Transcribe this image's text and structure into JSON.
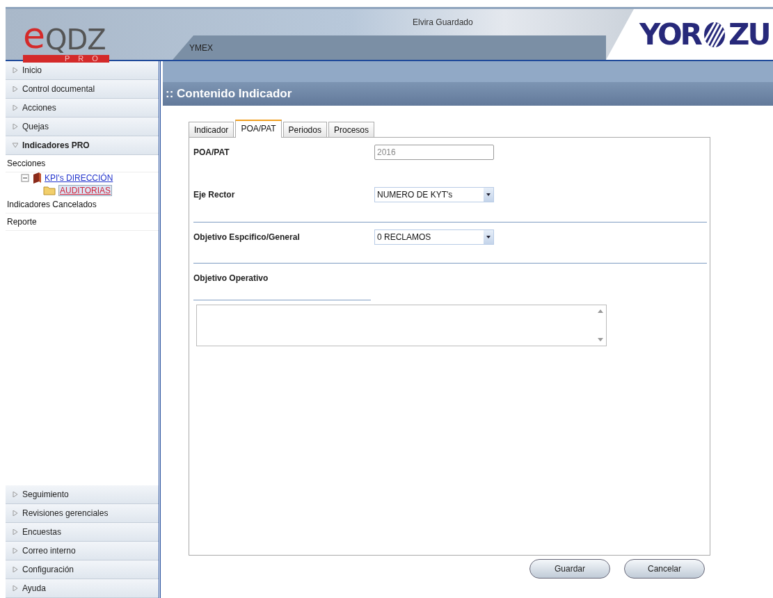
{
  "header": {
    "logo": {
      "mark": "e",
      "name": "QDZ",
      "sub": "PRO"
    },
    "company": "YMEX",
    "user": "Elvira Guardado",
    "brand": {
      "left": "YOR",
      "right": "ZU"
    }
  },
  "sidebar": {
    "items": [
      {
        "label": "Inicio",
        "expanded": false
      },
      {
        "label": "Control documental",
        "expanded": false
      },
      {
        "label": "Acciones",
        "expanded": false
      },
      {
        "label": "Quejas",
        "expanded": false
      },
      {
        "label": "Indicadores PRO",
        "expanded": true,
        "children": [
          {
            "kind": "link",
            "label": "Secciones"
          },
          {
            "kind": "tree",
            "label": "KPI's DIRECCIÓN",
            "expanded": true,
            "children": [
              {
                "label": "AUDITORIAS",
                "selected": true
              }
            ]
          },
          {
            "kind": "link",
            "label": "Indicadores Cancelados"
          },
          {
            "kind": "link",
            "label": "Reporte"
          }
        ]
      }
    ],
    "bottom_items": [
      {
        "label": "Seguimiento",
        "expanded": false
      },
      {
        "label": "Revisiones gerenciales",
        "expanded": false
      },
      {
        "label": "Encuestas",
        "expanded": false
      },
      {
        "label": "Correo interno",
        "expanded": false
      },
      {
        "label": "Configuración",
        "expanded": false
      },
      {
        "label": "Ayuda",
        "expanded": false
      }
    ]
  },
  "content": {
    "title": ":: Contenido Indicador",
    "tabs": [
      {
        "label": "Indicador",
        "selected": false
      },
      {
        "label": "POA/PAT",
        "selected": true
      },
      {
        "label": "Periodos",
        "selected": false
      },
      {
        "label": "Procesos",
        "selected": false
      }
    ],
    "fields": [
      {
        "kind": "text",
        "label": "POA/PAT",
        "value": "2016",
        "disabled": true
      },
      {
        "kind": "select",
        "label": "Eje Rector",
        "value": "NUMERO DE KYT's"
      },
      {
        "kind": "select",
        "label": "Objetivo Espcifico/General",
        "value": "0 RECLAMOS"
      },
      {
        "kind": "textarea",
        "label": "Objetivo Operativo"
      }
    ],
    "buttons": [
      "Guardar",
      "Cancelar"
    ]
  }
}
